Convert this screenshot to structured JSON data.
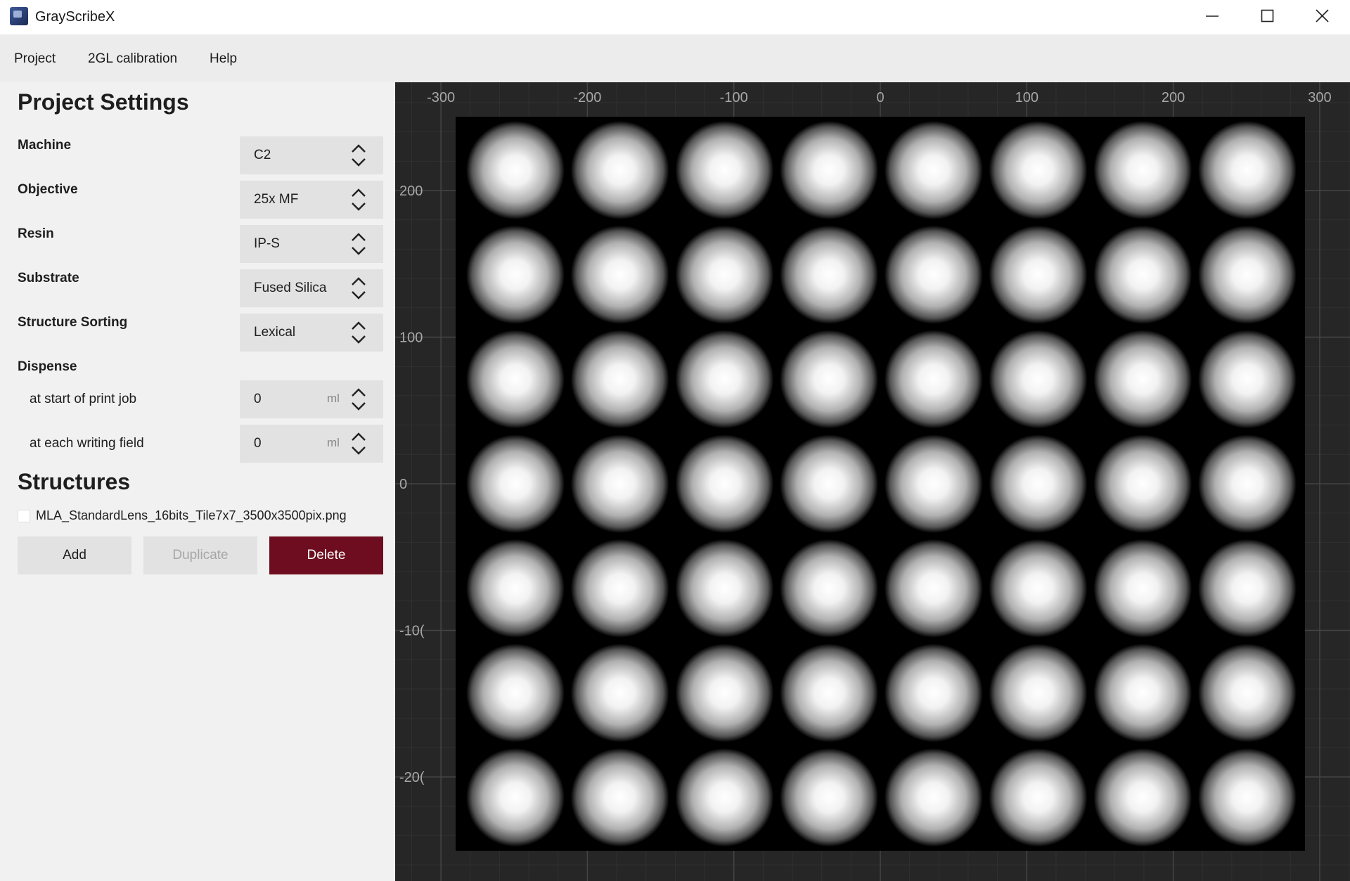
{
  "window": {
    "title": "GrayScribeX"
  },
  "menu": {
    "items": [
      "Project",
      "2GL calibration",
      "Help"
    ]
  },
  "settings": {
    "heading": "Project Settings",
    "machine": {
      "label": "Machine",
      "value": "C2"
    },
    "objective": {
      "label": "Objective",
      "value": "25x MF"
    },
    "resin": {
      "label": "Resin",
      "value": "IP-S"
    },
    "substrate": {
      "label": "Substrate",
      "value": "Fused Silica"
    },
    "sorting": {
      "label": "Structure Sorting",
      "value": "Lexical"
    },
    "dispense": {
      "label": "Dispense",
      "start": {
        "label": "at start of print job",
        "value": "0",
        "unit": "ml"
      },
      "field": {
        "label": "at each writing field",
        "value": "0",
        "unit": "ml"
      }
    }
  },
  "structures": {
    "heading": "Structures",
    "items": [
      {
        "name": "MLA_StandardLens_16bits_Tile7x7_3500x3500pix.png",
        "checked": false
      }
    ],
    "buttons": {
      "add": "Add",
      "duplicate": "Duplicate",
      "delete": "Delete"
    }
  },
  "preview": {
    "x_ticks": [
      "-300",
      "-200",
      "-100",
      "0",
      "100",
      "200",
      "300"
    ],
    "y_ticks": [
      "200",
      "100",
      "0",
      "-10(",
      "-20("
    ],
    "lens_grid": {
      "columns": 8,
      "rows": 7
    },
    "colors": {
      "background": "#262626",
      "image_background": "#000000",
      "lens_center": "#ffffff"
    }
  }
}
